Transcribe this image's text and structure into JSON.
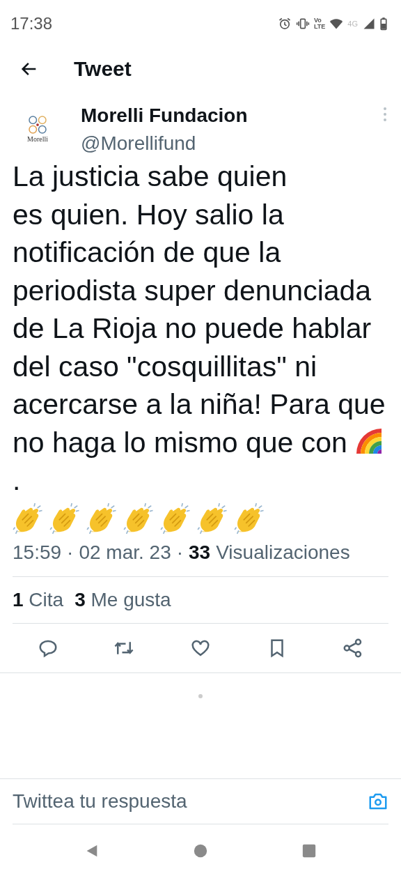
{
  "status_bar": {
    "time": "17:38",
    "volte_top": "Vo",
    "volte_bottom": "LTE",
    "network": "4G"
  },
  "header": {
    "title": "Tweet"
  },
  "author": {
    "logo_text": "Morelli",
    "name": "Morelli Fundacion",
    "handle": "@Morellifund"
  },
  "tweet": {
    "body": [
      {
        "kind": "text",
        "text": "La justicia sabe quien\nes quien. Hoy salio la notificación de que la periodista super denunciada de La Rioja no puede hablar del caso \"cosquillitas\" ni acercarse a la niña! Para que no haga lo mismo que con "
      },
      {
        "kind": "rainbow"
      },
      {
        "kind": "text",
        "text": "."
      }
    ],
    "emoji_row": [
      {
        "kind": "clap"
      },
      {
        "kind": "clap"
      },
      {
        "kind": "clap"
      },
      {
        "kind": "clap"
      },
      {
        "kind": "clap"
      },
      {
        "kind": "clap"
      },
      {
        "kind": "clap"
      }
    ],
    "time": "15:59",
    "separator": "·",
    "date": "02 mar. 23",
    "separator_2": "·",
    "views_count": "33",
    "views_label": "Visualizaciones"
  },
  "stats": [
    {
      "count": "1",
      "label": "Cita"
    },
    {
      "count": "3",
      "label": "Me gusta"
    }
  ],
  "actions": [
    {
      "kind": "reply"
    },
    {
      "kind": "retweet"
    },
    {
      "kind": "like"
    },
    {
      "kind": "bookmark"
    },
    {
      "kind": "share"
    }
  ],
  "reply_box": {
    "placeholder": "Twittea tu respuesta"
  }
}
